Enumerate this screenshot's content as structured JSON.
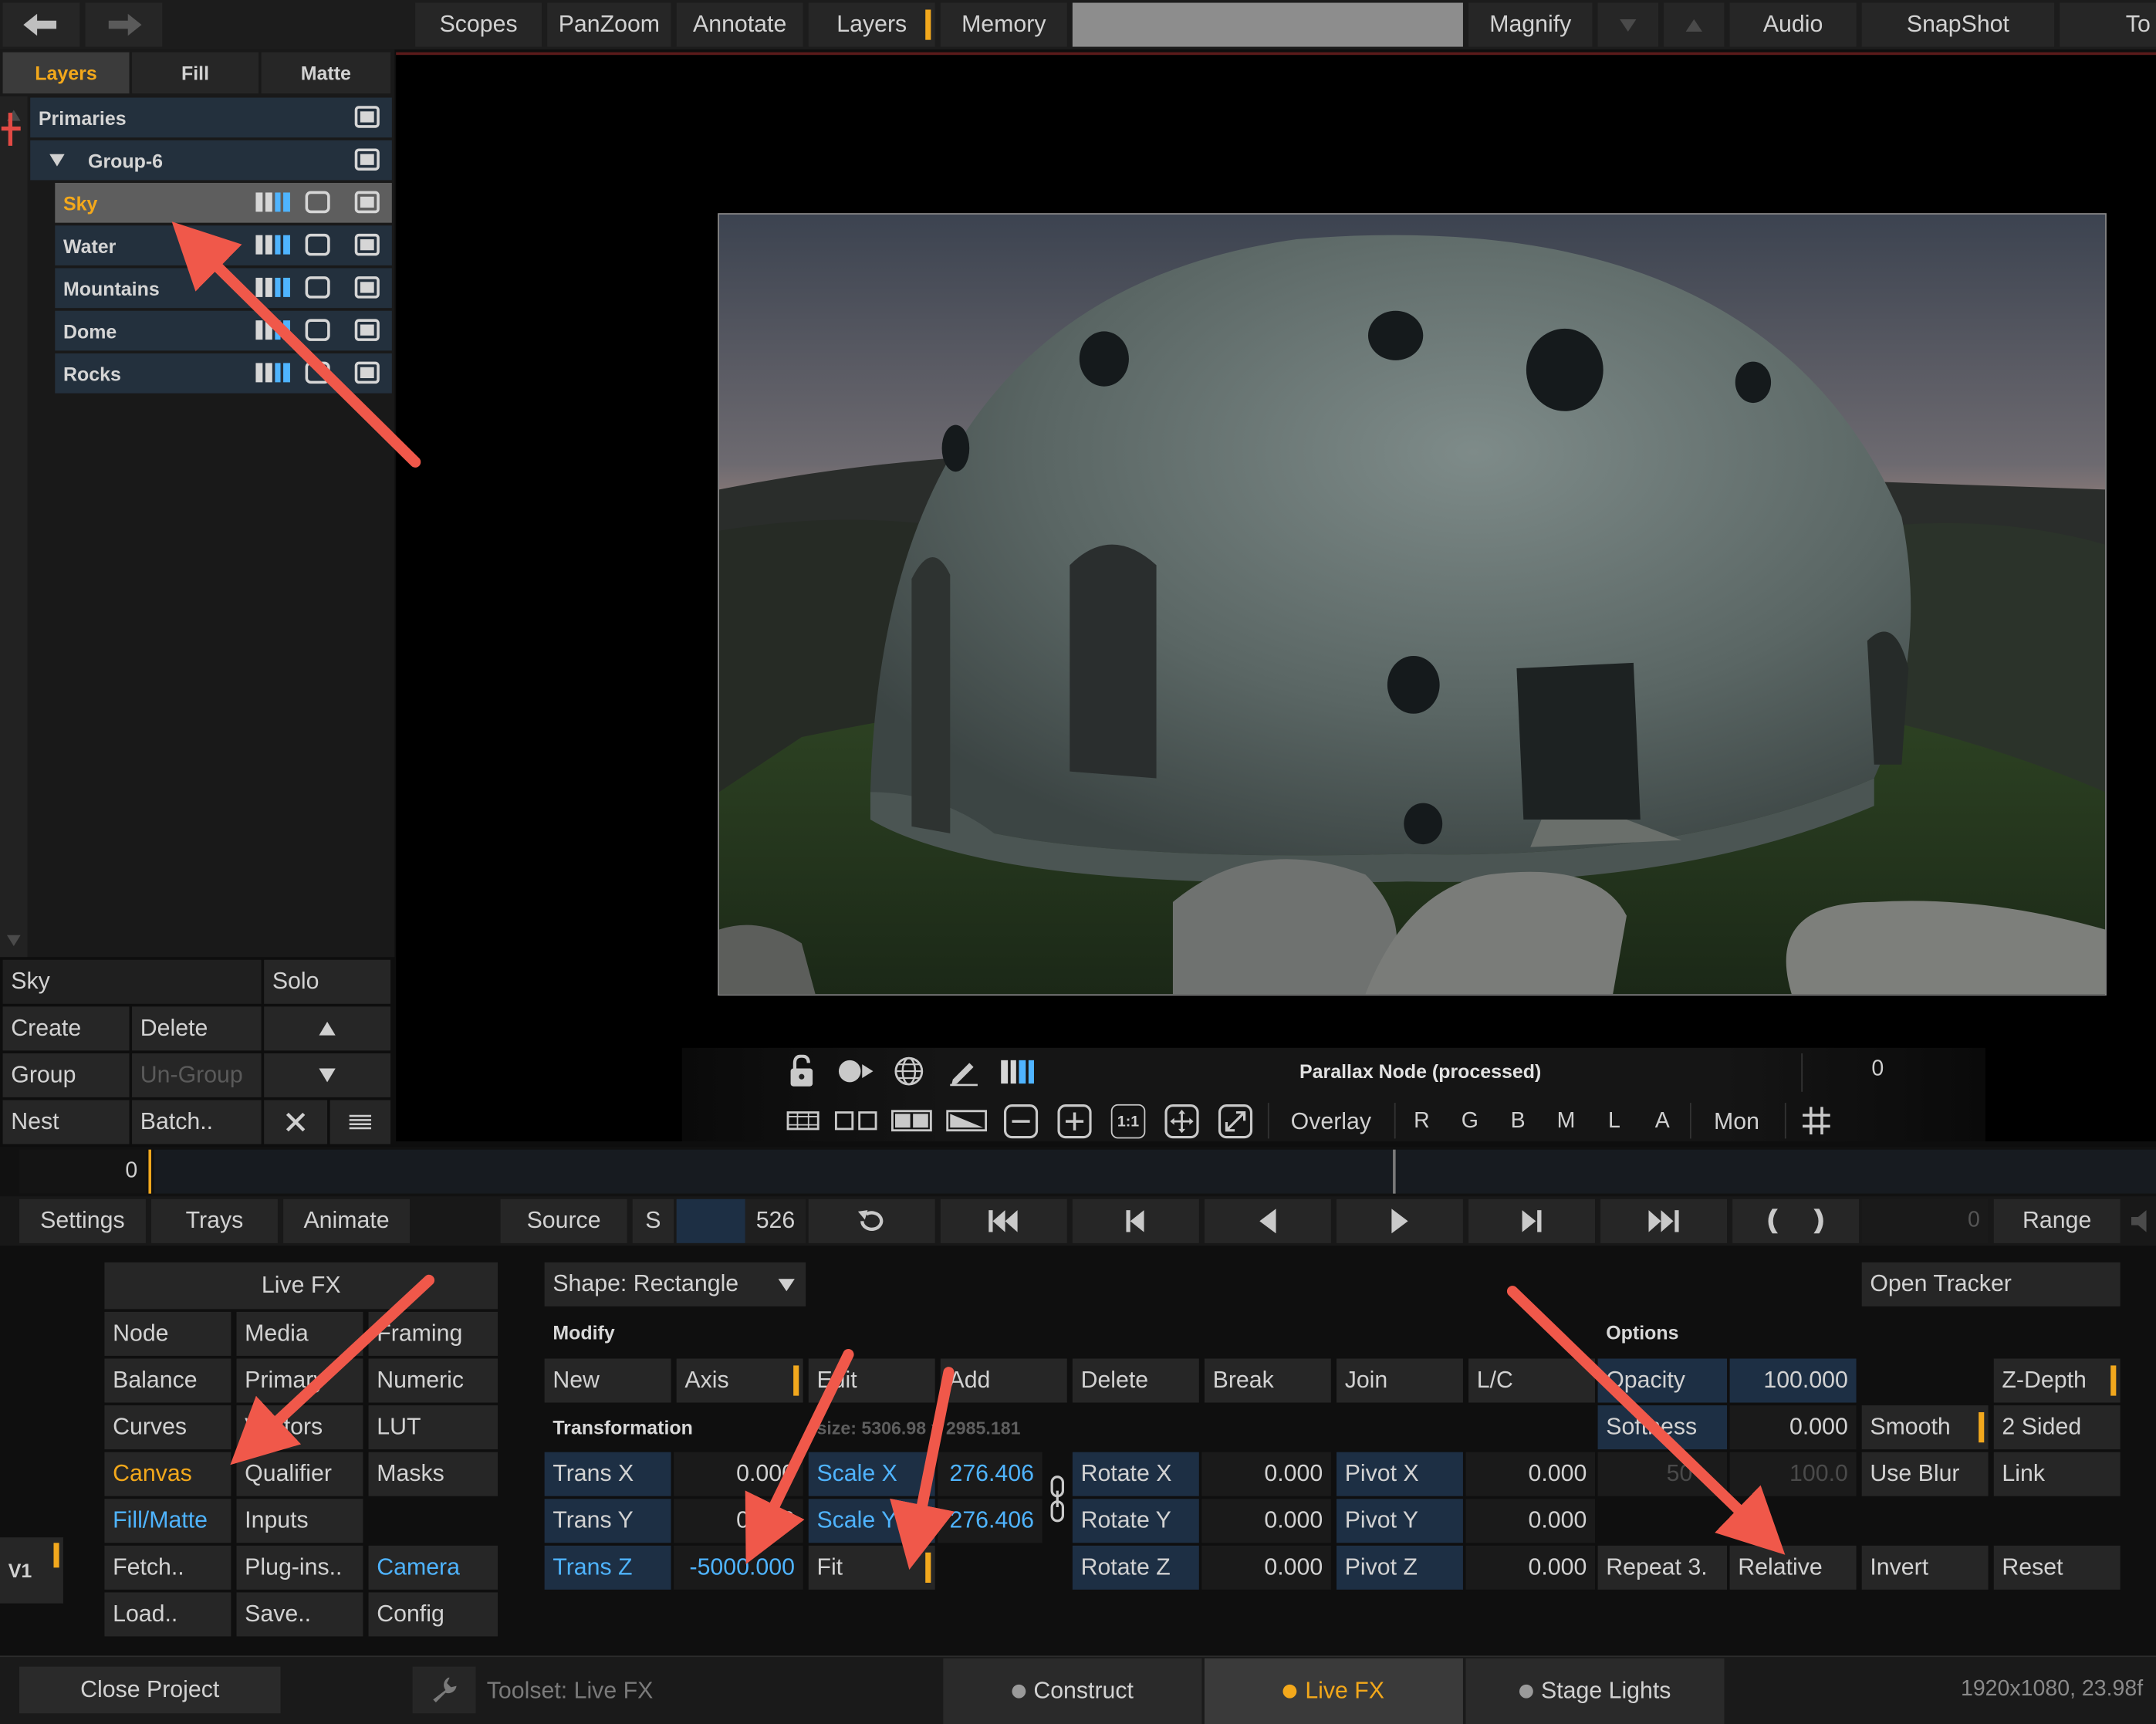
{
  "top_bar": {
    "back_icon": "arrow-left-icon",
    "forward_icon": "arrow-right-icon",
    "buttons": [
      "Scopes",
      "PanZoom",
      "Annotate",
      "Layers",
      "Memory",
      "Magnify",
      "Audio",
      "SnapShot",
      "To"
    ]
  },
  "layers_panel": {
    "tabs": [
      "Layers",
      "Fill",
      "Matte"
    ],
    "active_tab": "Layers",
    "root": "Primaries",
    "group": "Group-6",
    "layers": [
      "Sky",
      "Water",
      "Mountains",
      "Dome",
      "Rocks"
    ],
    "selected_layer": "Sky"
  },
  "layer_controls": {
    "name": "Sky",
    "solo": "Solo",
    "create": "Create",
    "delete": "Delete",
    "group": "Group",
    "ungroup": "Un-Group",
    "nest": "Nest",
    "batch": "Batch.."
  },
  "viewer": {
    "node_label": "Parallax Node (processed)",
    "frame_value": "0",
    "overlay": "Overlay",
    "channels": [
      "R",
      "G",
      "B",
      "M",
      "L",
      "A"
    ],
    "mon": "Mon",
    "zoom_one": "1:1"
  },
  "timeline": {
    "start_frame": "0",
    "settings": "Settings",
    "trays": "Trays",
    "animate": "Animate",
    "source": "Source",
    "s": "S",
    "frame_count": "526",
    "range_value": "0",
    "range": "Range"
  },
  "livefx_menu": {
    "title": "Live FX",
    "items": [
      [
        "Node",
        "Media",
        "Framing"
      ],
      [
        "Balance",
        "Primary",
        "Numeric"
      ],
      [
        "Curves",
        "Vectors",
        "LUT"
      ],
      [
        "Canvas",
        "Qualifier",
        "Masks"
      ],
      [
        "Fill/Matte",
        "Inputs",
        ""
      ],
      [
        "Fetch..",
        "Plug-ins..",
        "Camera"
      ],
      [
        "Load..",
        "Save..",
        "Config"
      ]
    ],
    "v1": "V1"
  },
  "shape_panel": {
    "shape": "Shape: Rectangle",
    "modify": "Modify",
    "options": "Options",
    "open_tracker": "Open Tracker",
    "modify_buttons": [
      "New",
      "Axis",
      "Edit",
      "Add",
      "Delete",
      "Break",
      "Join",
      "L/C"
    ],
    "transformation": "Transformation",
    "size": "size: 5306.98 x 2985.181",
    "trans": [
      {
        "label": "Trans X",
        "value": "0.000"
      },
      {
        "label": "Trans Y",
        "value": "0.000"
      },
      {
        "label": "Trans Z",
        "value": "-5000.000"
      }
    ],
    "scale": [
      {
        "label": "Scale X",
        "value": "276.406"
      },
      {
        "label": "Scale Y",
        "value": "276.406"
      }
    ],
    "fit": "Fit",
    "rotate": [
      {
        "label": "Rotate X",
        "value": "0.000"
      },
      {
        "label": "Rotate Y",
        "value": "0.000"
      },
      {
        "label": "Rotate Z",
        "value": "0.000"
      }
    ],
    "pivot": [
      {
        "label": "Pivot X",
        "value": "0.000"
      },
      {
        "label": "Pivot Y",
        "value": "0.000"
      },
      {
        "label": "Pivot Z",
        "value": "0.000"
      }
    ],
    "opacity": {
      "label": "Opacity",
      "value": "100.000"
    },
    "softness": {
      "label": "Softness",
      "value": "0.000"
    },
    "dim_left": "50",
    "dim_right": "100.0",
    "smooth": "Smooth",
    "use_blur": "Use Blur",
    "z_depth": "Z-Depth",
    "two_sided": "2 Sided",
    "link": "Link",
    "repeat": "Repeat 3.",
    "relative": "Relative",
    "invert": "Invert",
    "reset": "Reset"
  },
  "status_bar": {
    "close_project": "Close Project",
    "toolset": "Toolset: Live FX",
    "tabs": [
      "Construct",
      "Live FX",
      "Stage Lights"
    ],
    "active_tab": "Live FX",
    "format": "1920x1080, 23.98f"
  },
  "colors": {
    "accent": "#f3a81b",
    "blue_text": "#4fb4ff",
    "blue_field": "#1d2f44",
    "annotation_arrow": "#f0584a"
  }
}
